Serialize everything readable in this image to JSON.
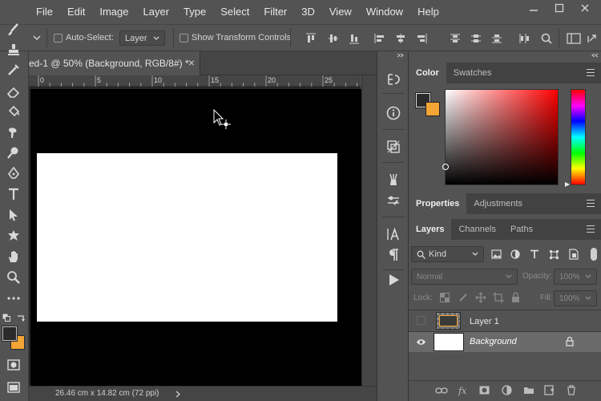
{
  "menubar": {
    "items": [
      "File",
      "Edit",
      "Image",
      "Layer",
      "Type",
      "Select",
      "Filter",
      "3D",
      "View",
      "Window",
      "Help"
    ]
  },
  "options": {
    "auto_select_label": "Auto-Select:",
    "layer_select_value": "Layer",
    "show_transform_label": "Show Transform Controls"
  },
  "document": {
    "tab_title": "ed-1 @ 50% (Background, RGB/8#) *",
    "close_glyph": "×",
    "ruler_ticks": [
      "0",
      "5",
      "10",
      "15",
      "20",
      "25"
    ],
    "status": "26.46 cm x 14.82 cm (72 ppi)"
  },
  "panels": {
    "color_tabs": [
      "Color",
      "Swatches"
    ],
    "props_tabs": [
      "Properties",
      "Adjustments"
    ],
    "layers_tabs": [
      "Layers",
      "Channels",
      "Paths"
    ],
    "filter_kind": "Kind",
    "blend_mode": "Normal",
    "opacity_label": "Opacity:",
    "opacity_value": "100%",
    "lock_label": "Lock:",
    "fill_label": "Fill:",
    "fill_value": "100%",
    "layers": [
      {
        "name": "Layer 1"
      },
      {
        "name": "Background"
      }
    ]
  },
  "colors": {
    "foreground": "#2b2b2b",
    "background": "#f3a535"
  }
}
